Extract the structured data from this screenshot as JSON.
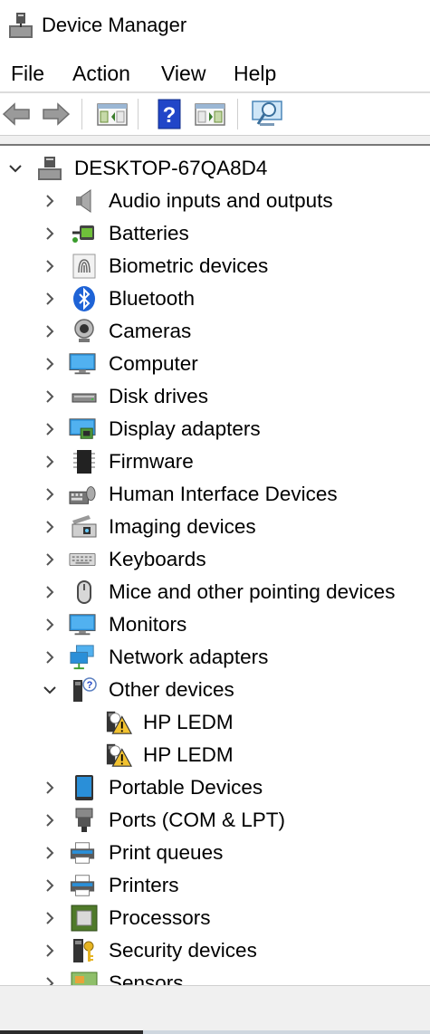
{
  "window": {
    "title": "Device Manager"
  },
  "menu": [
    "File",
    "Action",
    "View",
    "Help"
  ],
  "toolbar": [
    {
      "name": "back-button",
      "icon": "back-arrow-icon"
    },
    {
      "name": "forward-button",
      "icon": "forward-arrow-icon"
    },
    {
      "name": "show-hide-console-tree-button",
      "icon": "console-tree-icon"
    },
    {
      "name": "help-button",
      "icon": "help-icon"
    },
    {
      "name": "show-action-pane-button",
      "icon": "action-pane-icon"
    },
    {
      "name": "scan-hardware-button",
      "icon": "scan-monitor-icon"
    }
  ],
  "tree": {
    "root": {
      "label": "DESKTOP-67QA8D4",
      "expanded": true,
      "icon": "computer-tower-icon"
    },
    "items": [
      {
        "label": "Audio inputs and outputs",
        "icon": "speaker-icon"
      },
      {
        "label": "Batteries",
        "icon": "battery-icon"
      },
      {
        "label": "Biometric devices",
        "icon": "fingerprint-icon"
      },
      {
        "label": "Bluetooth",
        "icon": "bluetooth-icon"
      },
      {
        "label": "Cameras",
        "icon": "camera-icon"
      },
      {
        "label": "Computer",
        "icon": "monitor-icon"
      },
      {
        "label": "Disk drives",
        "icon": "disk-drive-icon"
      },
      {
        "label": "Display adapters",
        "icon": "display-adapter-icon"
      },
      {
        "label": "Firmware",
        "icon": "chip-icon"
      },
      {
        "label": "Human Interface Devices",
        "icon": "hid-icon"
      },
      {
        "label": "Imaging devices",
        "icon": "scanner-icon"
      },
      {
        "label": "Keyboards",
        "icon": "keyboard-icon"
      },
      {
        "label": "Mice and other pointing devices",
        "icon": "mouse-icon"
      },
      {
        "label": "Monitors",
        "icon": "monitor-icon"
      },
      {
        "label": "Network adapters",
        "icon": "network-icon"
      },
      {
        "label": "Other devices",
        "icon": "unknown-device-icon",
        "expanded": true,
        "children": [
          {
            "label": "HP LEDM",
            "icon": "warning-device-icon"
          },
          {
            "label": "HP LEDM",
            "icon": "warning-device-icon"
          }
        ]
      },
      {
        "label": "Portable Devices",
        "icon": "portable-device-icon"
      },
      {
        "label": "Ports (COM & LPT)",
        "icon": "port-icon"
      },
      {
        "label": "Print queues",
        "icon": "printer-icon"
      },
      {
        "label": "Printers",
        "icon": "printer-icon"
      },
      {
        "label": "Processors",
        "icon": "processor-icon"
      },
      {
        "label": "Security devices",
        "icon": "security-key-icon"
      },
      {
        "label": "Sensors",
        "icon": "sensor-icon"
      }
    ]
  },
  "colors": {
    "bluetooth": "#1e63d6",
    "monitor": "#2a8fd8",
    "warning": "#f2c230",
    "help": "#2146c8"
  }
}
